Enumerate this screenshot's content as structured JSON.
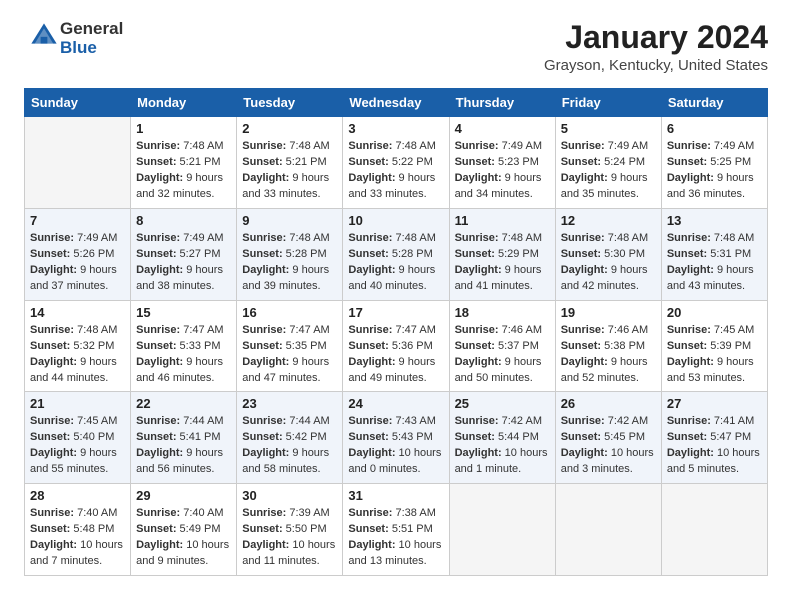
{
  "header": {
    "logo_general": "General",
    "logo_blue": "Blue",
    "month_title": "January 2024",
    "location": "Grayson, Kentucky, United States"
  },
  "days_of_week": [
    "Sunday",
    "Monday",
    "Tuesday",
    "Wednesday",
    "Thursday",
    "Friday",
    "Saturday"
  ],
  "weeks": [
    [
      {
        "day": "",
        "empty": true
      },
      {
        "day": "1",
        "sunrise": "7:48 AM",
        "sunset": "5:21 PM",
        "daylight": "9 hours and 32 minutes."
      },
      {
        "day": "2",
        "sunrise": "7:48 AM",
        "sunset": "5:21 PM",
        "daylight": "9 hours and 33 minutes."
      },
      {
        "day": "3",
        "sunrise": "7:48 AM",
        "sunset": "5:22 PM",
        "daylight": "9 hours and 33 minutes."
      },
      {
        "day": "4",
        "sunrise": "7:49 AM",
        "sunset": "5:23 PM",
        "daylight": "9 hours and 34 minutes."
      },
      {
        "day": "5",
        "sunrise": "7:49 AM",
        "sunset": "5:24 PM",
        "daylight": "9 hours and 35 minutes."
      },
      {
        "day": "6",
        "sunrise": "7:49 AM",
        "sunset": "5:25 PM",
        "daylight": "9 hours and 36 minutes."
      }
    ],
    [
      {
        "day": "7",
        "sunrise": "7:49 AM",
        "sunset": "5:26 PM",
        "daylight": "9 hours and 37 minutes."
      },
      {
        "day": "8",
        "sunrise": "7:49 AM",
        "sunset": "5:27 PM",
        "daylight": "9 hours and 38 minutes."
      },
      {
        "day": "9",
        "sunrise": "7:48 AM",
        "sunset": "5:28 PM",
        "daylight": "9 hours and 39 minutes."
      },
      {
        "day": "10",
        "sunrise": "7:48 AM",
        "sunset": "5:28 PM",
        "daylight": "9 hours and 40 minutes."
      },
      {
        "day": "11",
        "sunrise": "7:48 AM",
        "sunset": "5:29 PM",
        "daylight": "9 hours and 41 minutes."
      },
      {
        "day": "12",
        "sunrise": "7:48 AM",
        "sunset": "5:30 PM",
        "daylight": "9 hours and 42 minutes."
      },
      {
        "day": "13",
        "sunrise": "7:48 AM",
        "sunset": "5:31 PM",
        "daylight": "9 hours and 43 minutes."
      }
    ],
    [
      {
        "day": "14",
        "sunrise": "7:48 AM",
        "sunset": "5:32 PM",
        "daylight": "9 hours and 44 minutes."
      },
      {
        "day": "15",
        "sunrise": "7:47 AM",
        "sunset": "5:33 PM",
        "daylight": "9 hours and 46 minutes."
      },
      {
        "day": "16",
        "sunrise": "7:47 AM",
        "sunset": "5:35 PM",
        "daylight": "9 hours and 47 minutes."
      },
      {
        "day": "17",
        "sunrise": "7:47 AM",
        "sunset": "5:36 PM",
        "daylight": "9 hours and 49 minutes."
      },
      {
        "day": "18",
        "sunrise": "7:46 AM",
        "sunset": "5:37 PM",
        "daylight": "9 hours and 50 minutes."
      },
      {
        "day": "19",
        "sunrise": "7:46 AM",
        "sunset": "5:38 PM",
        "daylight": "9 hours and 52 minutes."
      },
      {
        "day": "20",
        "sunrise": "7:45 AM",
        "sunset": "5:39 PM",
        "daylight": "9 hours and 53 minutes."
      }
    ],
    [
      {
        "day": "21",
        "sunrise": "7:45 AM",
        "sunset": "5:40 PM",
        "daylight": "9 hours and 55 minutes."
      },
      {
        "day": "22",
        "sunrise": "7:44 AM",
        "sunset": "5:41 PM",
        "daylight": "9 hours and 56 minutes."
      },
      {
        "day": "23",
        "sunrise": "7:44 AM",
        "sunset": "5:42 PM",
        "daylight": "9 hours and 58 minutes."
      },
      {
        "day": "24",
        "sunrise": "7:43 AM",
        "sunset": "5:43 PM",
        "daylight": "10 hours and 0 minutes."
      },
      {
        "day": "25",
        "sunrise": "7:42 AM",
        "sunset": "5:44 PM",
        "daylight": "10 hours and 1 minute."
      },
      {
        "day": "26",
        "sunrise": "7:42 AM",
        "sunset": "5:45 PM",
        "daylight": "10 hours and 3 minutes."
      },
      {
        "day": "27",
        "sunrise": "7:41 AM",
        "sunset": "5:47 PM",
        "daylight": "10 hours and 5 minutes."
      }
    ],
    [
      {
        "day": "28",
        "sunrise": "7:40 AM",
        "sunset": "5:48 PM",
        "daylight": "10 hours and 7 minutes."
      },
      {
        "day": "29",
        "sunrise": "7:40 AM",
        "sunset": "5:49 PM",
        "daylight": "10 hours and 9 minutes."
      },
      {
        "day": "30",
        "sunrise": "7:39 AM",
        "sunset": "5:50 PM",
        "daylight": "10 hours and 11 minutes."
      },
      {
        "day": "31",
        "sunrise": "7:38 AM",
        "sunset": "5:51 PM",
        "daylight": "10 hours and 13 minutes."
      },
      {
        "day": "",
        "empty": true
      },
      {
        "day": "",
        "empty": true
      },
      {
        "day": "",
        "empty": true
      }
    ]
  ],
  "labels": {
    "sunrise": "Sunrise:",
    "sunset": "Sunset:",
    "daylight": "Daylight:"
  }
}
